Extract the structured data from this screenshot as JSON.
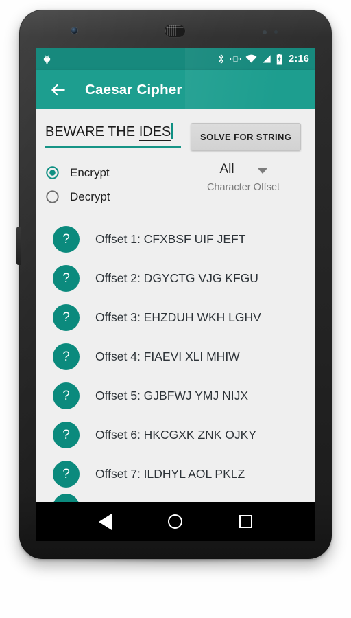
{
  "status_bar": {
    "notification_icon": "android-robot-icon",
    "icons": [
      "bluetooth-icon",
      "vibrate-icon",
      "wifi-icon",
      "cellular-signal-icon",
      "battery-charging-icon"
    ],
    "clock": "2:16"
  },
  "appbar": {
    "back_icon": "back-arrow-icon",
    "title": "Caesar Cipher",
    "background_color": "#1d9e8f"
  },
  "input": {
    "value_plain": "BEWARE THE ",
    "value_misspelled": "IDES",
    "full_value": "BEWARE THE IDES",
    "underline_color": "#169486"
  },
  "solve_button": {
    "label": "SOLVE FOR STRING"
  },
  "mode": {
    "options": [
      {
        "label": "Encrypt",
        "selected": true
      },
      {
        "label": "Decrypt",
        "selected": false
      }
    ],
    "selected_color": "#0f9083"
  },
  "spinner": {
    "value": "All",
    "label": "Character Offset",
    "caret_icon": "chevron-down-icon"
  },
  "results": {
    "badge_icon": "question-mark-icon",
    "badge_color": "#0b8a7d",
    "items": [
      {
        "text": "Offset 1: CFXBSF UIF JEFT"
      },
      {
        "text": "Offset 2: DGYCTG VJG KFGU"
      },
      {
        "text": "Offset 3: EHZDUH WKH LGHV"
      },
      {
        "text": "Offset 4: FIAEVI XLI MHIW"
      },
      {
        "text": "Offset 5: GJBFWJ YMJ NIJX"
      },
      {
        "text": "Offset 6: HKCGXK ZNK OJKY"
      },
      {
        "text": "Offset 7: ILDHYL AOL PKLZ"
      }
    ],
    "badge_glyph": "?"
  },
  "navbar": {
    "back": "back-triangle-icon",
    "home": "home-circle-icon",
    "recents": "recents-square-icon"
  }
}
